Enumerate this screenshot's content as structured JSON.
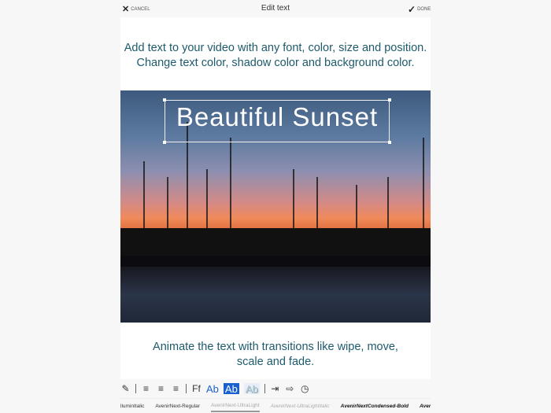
{
  "header": {
    "cancel": "CANCEL",
    "title": "Edit text",
    "done": "DONE"
  },
  "caption_top": [
    "Add text to your video with any font, color, size and position.",
    "Change text color, shadow color and background color."
  ],
  "overlay_text": "Beautiful Sunset",
  "caption_bottom": [
    "Animate the text with transitions like wipe, move,",
    "scale and fade."
  ],
  "toolbar": {
    "font_label": "Ff",
    "ab": "Ab"
  },
  "fonts": [
    "lluminItalic",
    "AvenirNext-Regular",
    "AvenirNext-UltraLight",
    "AvenirNext-UltraLightItalic",
    "AvenirNextCondensed-Bold",
    "AvenirNextCondensed-BoldItalic"
  ],
  "selected_font": "AvenirNext-UltraLight"
}
